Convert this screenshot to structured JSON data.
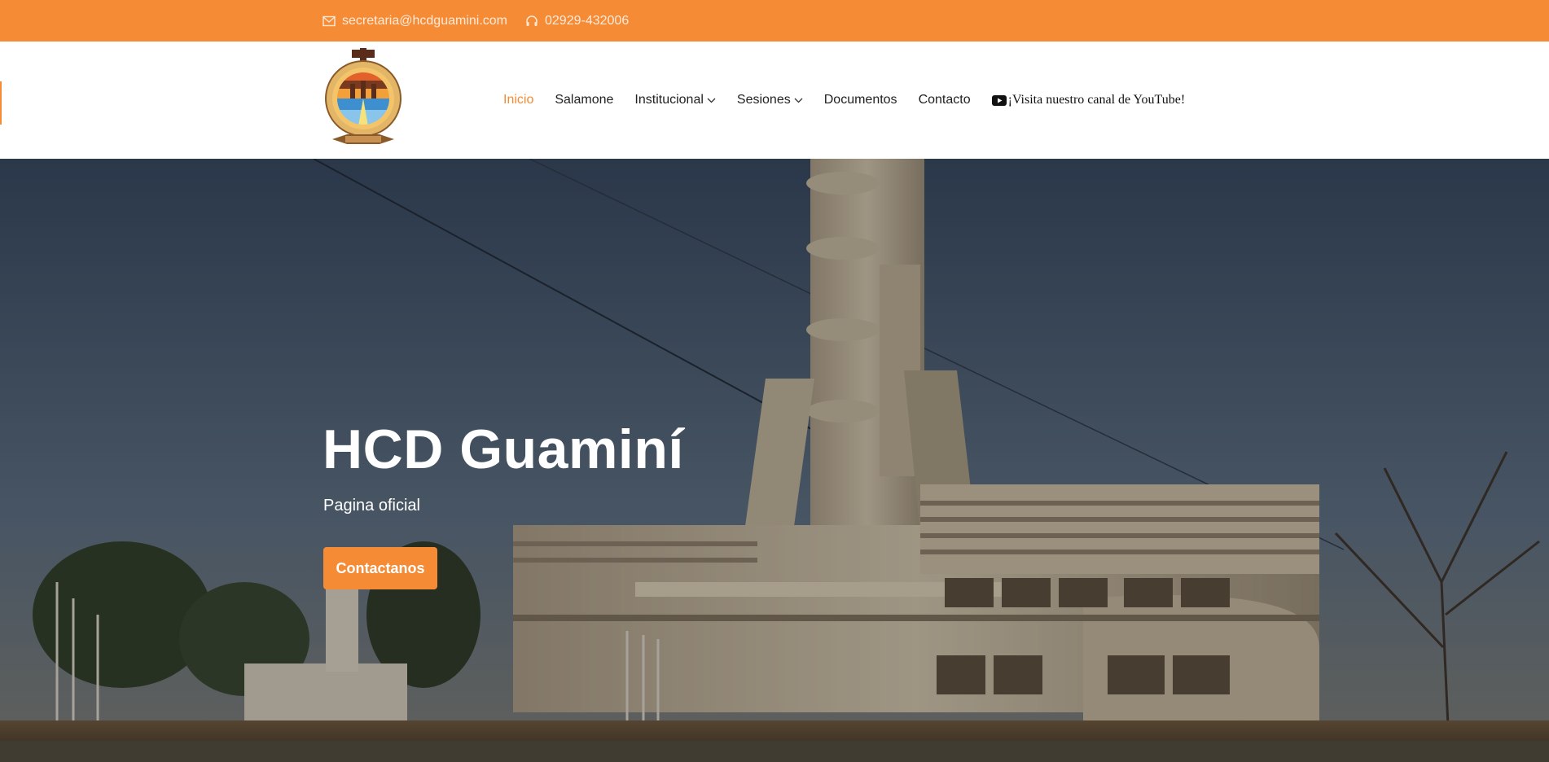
{
  "topbar": {
    "email": "secretaria@hcdguamini.com",
    "phone": "02929-432006",
    "email_icon": "envelope-icon",
    "phone_icon": "headphones-icon",
    "bg_color": "#f68b35"
  },
  "header": {
    "logo": "municipal-seal-logo",
    "nav": [
      {
        "label": "Inicio",
        "active": true
      },
      {
        "label": "Salamone"
      },
      {
        "label": "Institucional",
        "dropdown": true
      },
      {
        "label": "Sesiones",
        "dropdown": true
      },
      {
        "label": "Documentos"
      },
      {
        "label": "Contacto"
      }
    ],
    "youtube_label": "¡Visita nuestro canal de YouTube!",
    "youtube_icon": "youtube-icon"
  },
  "hero": {
    "title": "HCD Guaminí",
    "subtitle": "Pagina oficial",
    "button_label": "Contactanos"
  },
  "colors": {
    "accent": "#f68b35",
    "text": "#222222"
  }
}
